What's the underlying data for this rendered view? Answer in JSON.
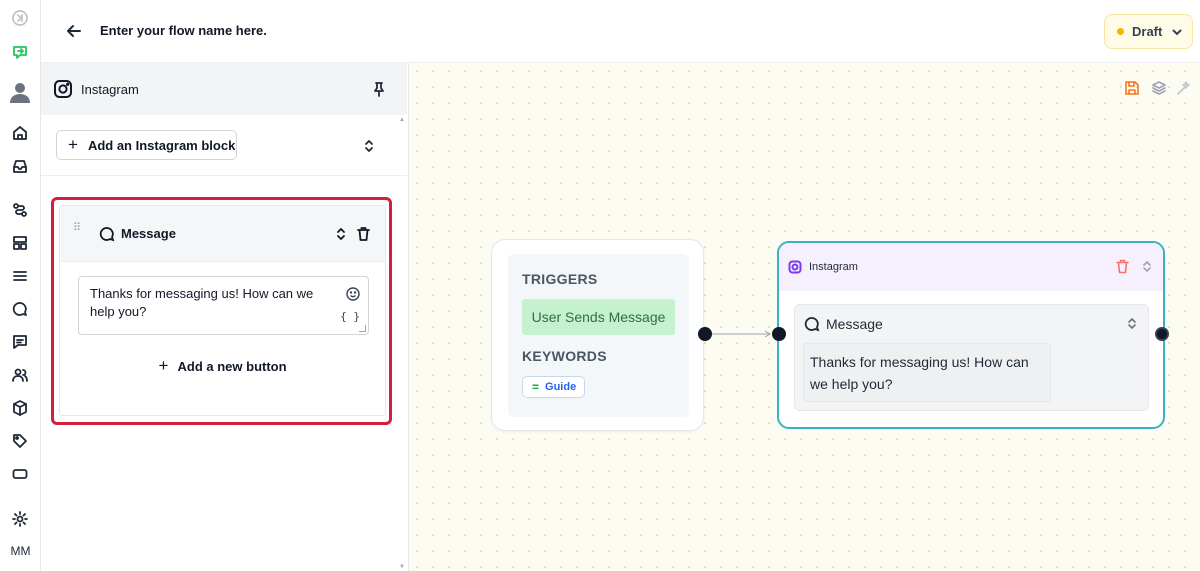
{
  "header": {
    "flow_name": "Enter your flow name here.",
    "status_label": "Draft",
    "status_color": "#f2b705"
  },
  "rail": {
    "icons": [
      "collapse-icon",
      "flow-icon",
      "user-avatar-icon",
      "home-icon",
      "inbox-icon",
      "routes-icon",
      "layout-icon",
      "list-icon",
      "chat-icon",
      "message-square-icon",
      "users-icon",
      "box-icon",
      "tag-icon",
      "card-icon",
      "settings-icon"
    ],
    "user_initials": "MM"
  },
  "panel": {
    "title": "Instagram",
    "add_block_label": "Add an Instagram block",
    "block": {
      "title": "Message",
      "text": "Thanks for messaging us! How can we help you?",
      "variables_glyph": "{ }",
      "add_button_label": "Add a new button",
      "highlight_color": "#d41f3a"
    }
  },
  "canvas": {
    "trigger_node": {
      "triggers_heading": "TRIGGERS",
      "trigger_value": "User Sends Message",
      "keywords_heading": "KEYWORDS",
      "keyword_value": "Guide"
    },
    "instagram_node": {
      "title": "Instagram",
      "message_title": "Message",
      "message_text": "Thanks for messaging us! How can we help you?",
      "border_color": "#39b3c4"
    }
  }
}
